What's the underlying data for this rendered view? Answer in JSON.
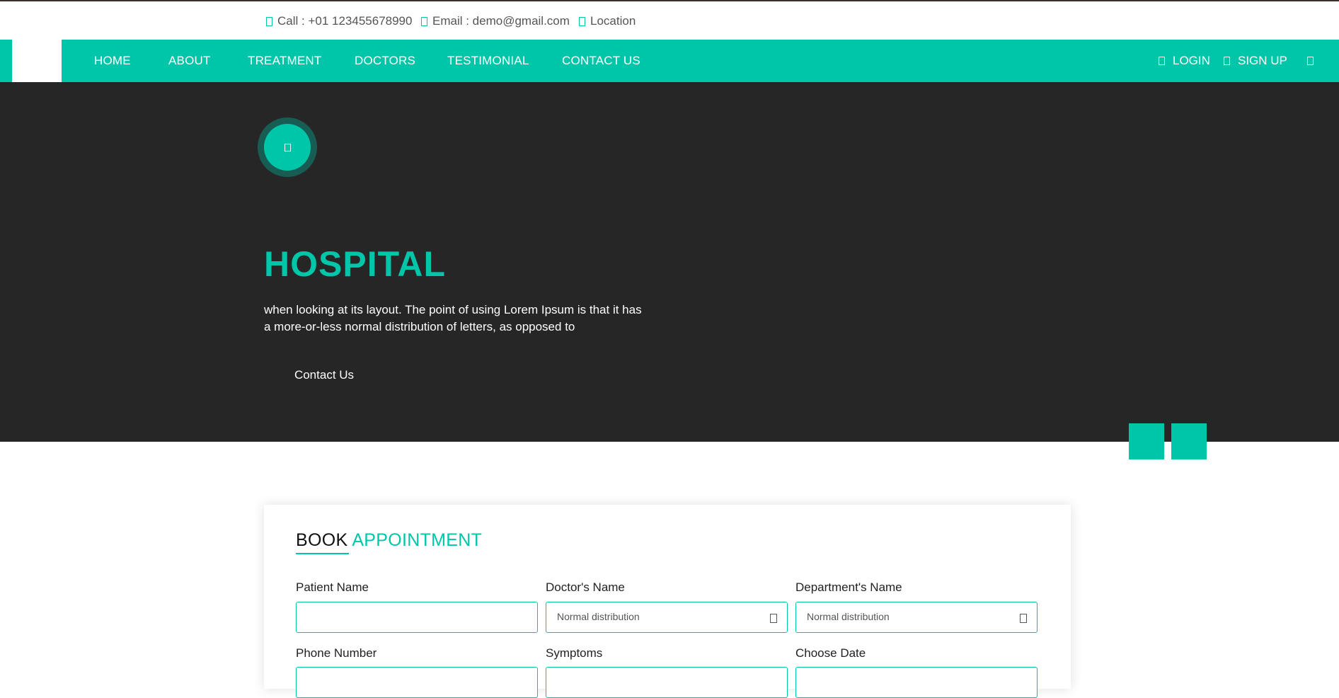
{
  "topbar": {
    "call": "Call : +01 123455678990",
    "email": "Email : demo@gmail.com",
    "location": "Location"
  },
  "nav": {
    "items": [
      "HOME",
      "ABOUT",
      "TREATMENT",
      "DOCTORS",
      "TESTIMONIAL",
      "CONTACT US"
    ],
    "login": "LOGIN",
    "signup": "SIGN UP"
  },
  "hero": {
    "title": "HOSPITAL",
    "text": "when looking at its layout. The point of using Lorem Ipsum is that it has a more-or-less normal distribution of letters, as opposed to",
    "button": "Contact Us"
  },
  "appointment": {
    "heading_part1": "BOOK",
    "heading_part2": "APPOINTMENT",
    "fields": {
      "patient_name": {
        "label": "Patient Name",
        "value": ""
      },
      "doctor_name": {
        "label": "Doctor's Name",
        "value": "Normal distribution"
      },
      "department_name": {
        "label": "Department's Name",
        "value": "Normal distribution"
      },
      "phone_number": {
        "label": "Phone Number"
      },
      "symptoms": {
        "label": "Symptoms"
      },
      "choose_date": {
        "label": "Choose Date"
      }
    }
  },
  "colors": {
    "accent": "#00c6a9",
    "hero_bg": "#262626"
  },
  "icons": {
    "call": "phone-icon",
    "email": "envelope-icon",
    "location": "map-marker-icon",
    "login": "user-icon",
    "signup": "user-plus-icon",
    "search": "search-icon",
    "play": "play-icon",
    "select": "chevron-down-icon"
  }
}
